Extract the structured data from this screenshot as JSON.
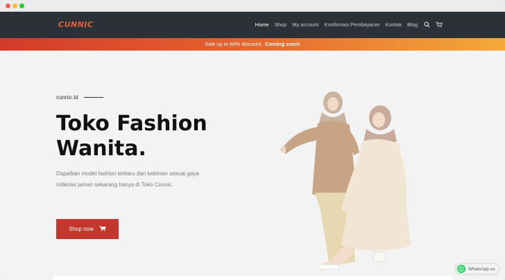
{
  "brand": {
    "logo_text": "CUNNIC",
    "logo_color": "#e0603a"
  },
  "nav": {
    "items": [
      {
        "label": "Home",
        "active": true
      },
      {
        "label": "Shop",
        "active": false
      },
      {
        "label": "My account",
        "active": false
      },
      {
        "label": "Konfirmasi Pembayaran",
        "active": false
      },
      {
        "label": "Kontak",
        "active": false
      },
      {
        "label": "Blog",
        "active": false
      }
    ],
    "icons": [
      "search-icon",
      "cart-icon"
    ]
  },
  "promo": {
    "text": "Sale up to 60% discount.",
    "highlight": "Coming soon!"
  },
  "hero": {
    "eyebrow": "cunnic.id",
    "headline_line1": "Toko Fashion",
    "headline_line2": "Wanita.",
    "description": "Dapatkan model fashion terbaru dan kekinian sesuai gaya millenial jaman sekarang hanya di Toko Cunnic.",
    "cta_label": "Shop now",
    "cta_color": "#c2382e"
  },
  "whatsapp": {
    "label": "WhatsApp us",
    "icon": "whatsapp-icon"
  },
  "colors": {
    "navbar": "#2c3137",
    "promo_start": "#d23b2a",
    "promo_end": "#f4a93a",
    "background": "#f3f3f3"
  }
}
